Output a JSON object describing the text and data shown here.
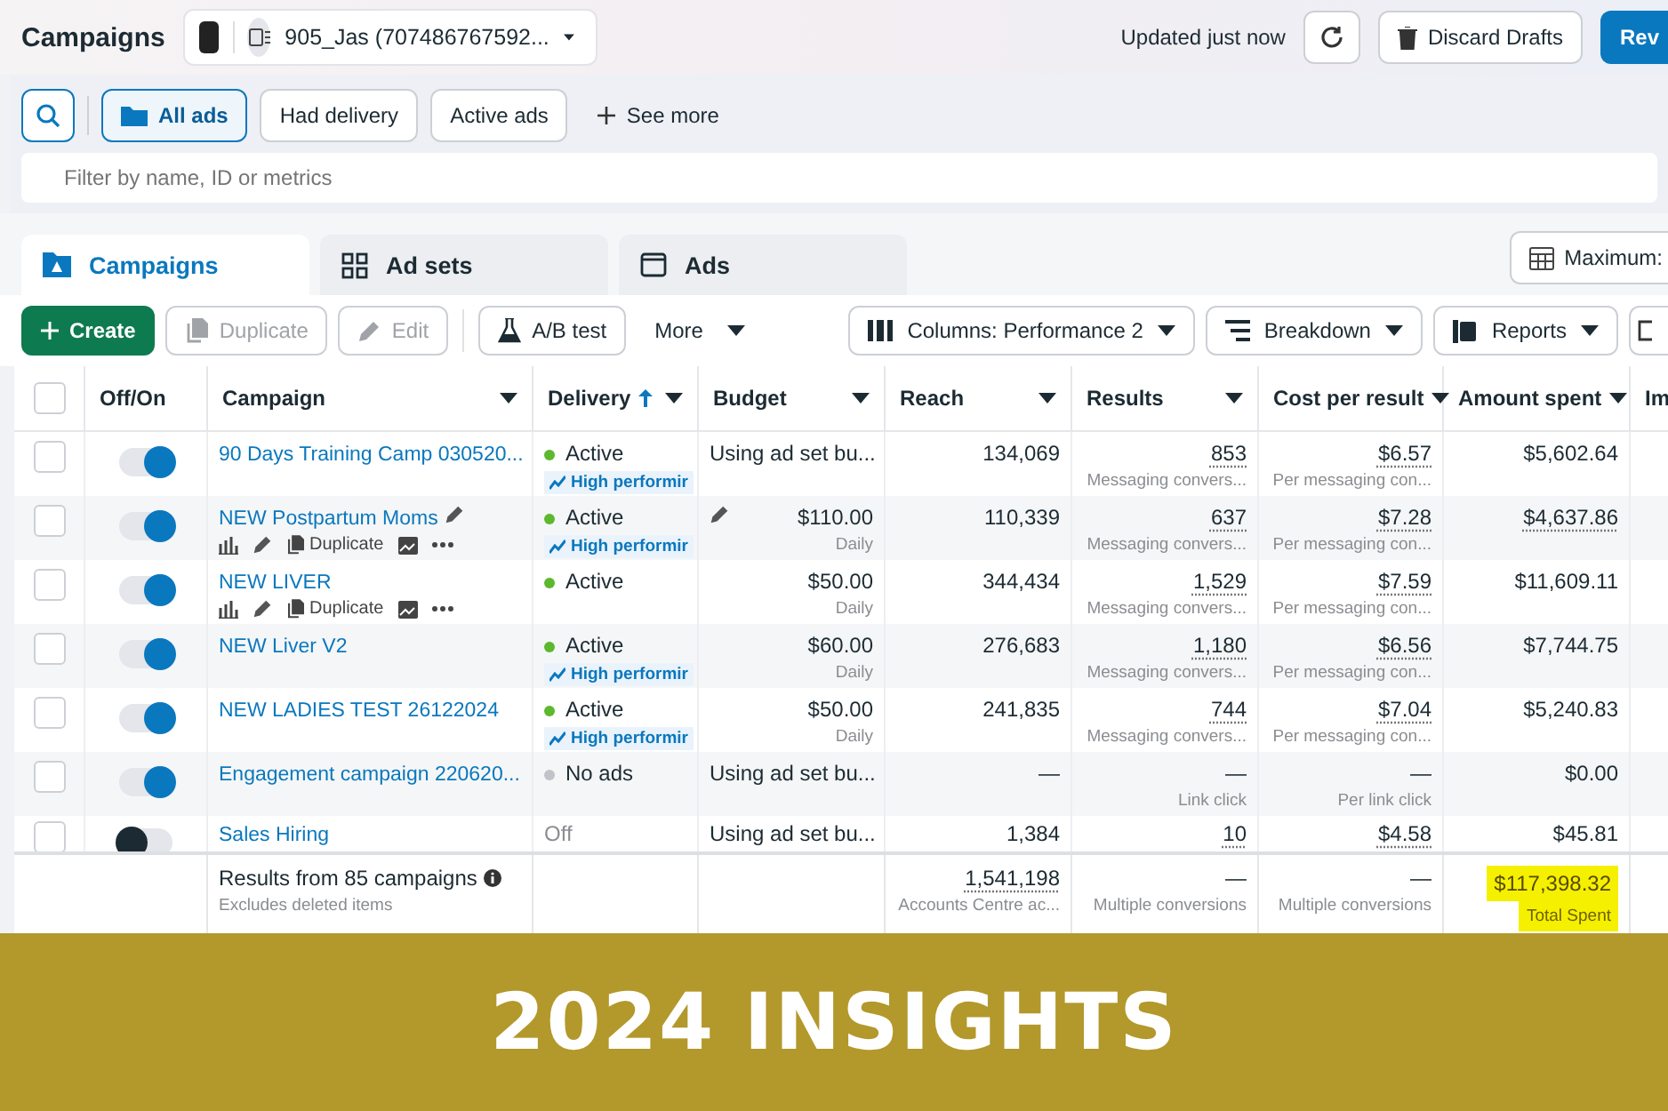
{
  "header": {
    "title": "Campaigns",
    "account": "905_Jas (707486767592...",
    "updated": "Updated just now",
    "discard": "Discard Drafts",
    "review": "Rev"
  },
  "filters": {
    "items": [
      {
        "label": "All ads",
        "selected": true
      },
      {
        "label": "Had delivery",
        "selected": false
      },
      {
        "label": "Active ads",
        "selected": false
      }
    ],
    "see_more": "See more",
    "placeholder": "Filter by name, ID or metrics"
  },
  "tabs": [
    {
      "label": "Campaigns",
      "selected": true
    },
    {
      "label": "Ad sets",
      "selected": false
    },
    {
      "label": "Ads",
      "selected": false
    }
  ],
  "maximum": "Maximum:",
  "toolbar": {
    "actions": [
      {
        "label": "Create",
        "kind": "primary",
        "disabled": false
      },
      {
        "label": "Duplicate",
        "kind": "default",
        "disabled": true
      },
      {
        "label": "Edit",
        "kind": "default",
        "disabled": true
      },
      {
        "label": "A/B test",
        "kind": "default",
        "disabled": false
      },
      {
        "label": "More",
        "kind": "menu",
        "disabled": false
      }
    ],
    "views": [
      "Columns: Performance 2",
      "Breakdown",
      "Reports"
    ]
  },
  "table": {
    "select_all": false,
    "columns": [
      {
        "label": "Off/On",
        "menu": false,
        "sorted": false
      },
      {
        "label": "Campaign",
        "menu": true,
        "sorted": false
      },
      {
        "label": "Delivery",
        "menu": true,
        "sorted": true
      },
      {
        "label": "Budget",
        "menu": true,
        "sorted": false
      },
      {
        "label": "Reach",
        "menu": true,
        "sorted": false
      },
      {
        "label": "Results",
        "menu": true,
        "sorted": false
      },
      {
        "label": "Cost per result",
        "menu": true,
        "sorted": false
      },
      {
        "label": "Amount spent",
        "menu": true,
        "sorted": false
      },
      {
        "label": "Im"
      }
    ],
    "rows": [
      {
        "selected": false,
        "on": true,
        "campaign": "90 Days Training Camp 030520...",
        "editing": false,
        "delivery": "Active",
        "color": "#5cb82d",
        "badge": "High performir",
        "budget": {
          "kind": "shared",
          "value": "Using ad set bu..."
        },
        "reach": "134,069",
        "results": "853",
        "results_sub": "Messaging convers...",
        "cost": "$6.57",
        "cost_sub": "Per messaging con...",
        "amount": "$5,602.64"
      },
      {
        "selected": false,
        "on": true,
        "campaign": "NEW Postpartum Moms",
        "editing": true,
        "duplicate": "Duplicate",
        "delivery": "Active",
        "color": "#5cb82d",
        "badge": "High performir",
        "budget": {
          "kind": "amount",
          "value": "$110.00",
          "sub": "Daily"
        },
        "reach": "110,339",
        "results": "637",
        "results_sub": "Messaging convers...",
        "cost": "$7.28",
        "cost_sub": "Per messaging con...",
        "amount": "$4,637.86"
      },
      {
        "selected": false,
        "on": true,
        "campaign": "NEW LIVER",
        "editing": false,
        "duplicate": "Duplicate",
        "delivery": "Active",
        "color": "#5cb82d",
        "budget": {
          "kind": "amount",
          "value": "$50.00",
          "sub": "Daily"
        },
        "reach": "344,434",
        "results": "1,529",
        "results_sub": "Messaging convers...",
        "cost": "$7.59",
        "cost_sub": "Per messaging con...",
        "amount": "$11,609.11"
      },
      {
        "selected": false,
        "on": true,
        "campaign": "NEW Liver V2",
        "editing": false,
        "delivery": "Active",
        "color": "#5cb82d",
        "badge": "High performir",
        "budget": {
          "kind": "amount",
          "value": "$60.00",
          "sub": "Daily"
        },
        "reach": "276,683",
        "results": "1,180",
        "results_sub": "Messaging convers...",
        "cost": "$6.56",
        "cost_sub": "Per messaging con...",
        "amount": "$7,744.75"
      },
      {
        "selected": false,
        "on": true,
        "campaign": "NEW LADIES TEST 26122024",
        "editing": false,
        "delivery": "Active",
        "color": "#5cb82d",
        "badge": "High performir",
        "budget": {
          "kind": "amount",
          "value": "$50.00",
          "sub": "Daily"
        },
        "reach": "241,835",
        "results": "744",
        "results_sub": "Messaging convers...",
        "cost": "$7.04",
        "cost_sub": "Per messaging con...",
        "amount": "$5,240.83"
      },
      {
        "selected": false,
        "on": true,
        "campaign": "Engagement campaign 220620...",
        "editing": false,
        "delivery": "No ads",
        "color": "#c0c3c8",
        "budget": {
          "kind": "shared",
          "value": "Using ad set bu..."
        },
        "reach": "—",
        "results": "—",
        "results_sub": "Link click",
        "cost": "—",
        "cost_sub": "Per link click",
        "amount": "$0.00"
      },
      {
        "selected": false,
        "on": false,
        "campaign": "Sales Hiring",
        "editing": false,
        "delivery": "Off",
        "budget": {
          "kind": "shared",
          "value": "Using ad set bu..."
        },
        "reach": "1,384",
        "results": "10",
        "cost": "$4.58",
        "amount": "$45.81"
      }
    ],
    "summary": {
      "label": "Results from 85 campaigns",
      "sub": "Excludes deleted items",
      "reach": "1,541,198",
      "reach_sub": "Accounts Centre ac...",
      "results": "—",
      "results_sub": "Multiple conversions",
      "cost": "—",
      "cost_sub": "Multiple conversions",
      "amount": "$117,398.32",
      "amount_sub": "Total Spent",
      "highlighted": true
    }
  },
  "banner": "2024 INSIGHTS"
}
